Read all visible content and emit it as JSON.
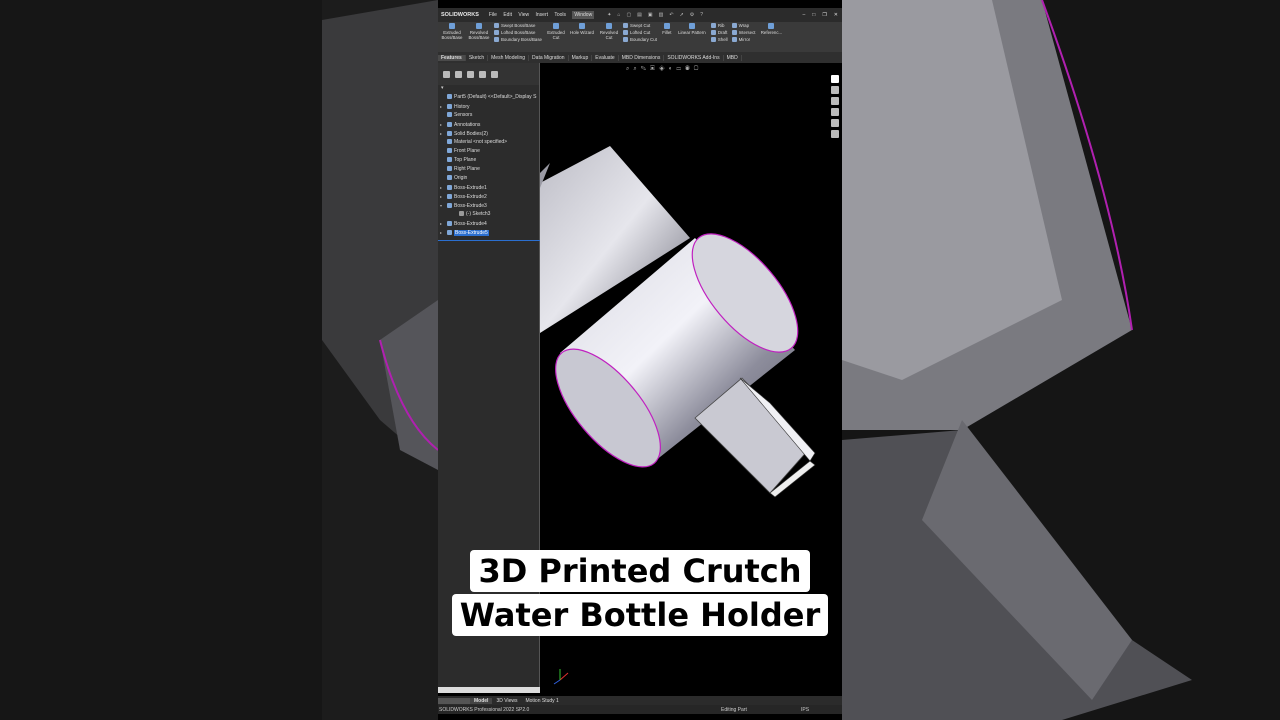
{
  "app": {
    "logo": "SOLIDWORKS",
    "menu": [
      "File",
      "Edit",
      "View",
      "Insert",
      "Tools",
      "Window"
    ],
    "active_menu": "Window"
  },
  "ribbon": {
    "extruded_boss": "Extruded Boss/Base",
    "revolved_boss": "Revolved Boss/Base",
    "swept_boss": "Swept Boss/Base",
    "lofted_boss": "Lofted Boss/Base",
    "boundary_boss": "Boundary Boss/Base",
    "extruded_cut": "Extruded Cut",
    "hole_wizard": "Hole Wizard",
    "revolved_cut": "Revolved Cut",
    "swept_cut": "Swept Cut",
    "lofted_cut": "Lofted Cut",
    "boundary_cut": "Boundary Cut",
    "fillet": "Fillet",
    "linear_pattern": "Linear Pattern",
    "rib": "Rib",
    "draft": "Draft",
    "shell": "Shell",
    "wrap": "Wrap",
    "intersect": "Intersect",
    "mirror": "Mirror",
    "reference": "Referenc..."
  },
  "tabs": [
    "Features",
    "Sketch",
    "Mesh Modeling",
    "Data Migration",
    "Markup",
    "Evaluate",
    "MBD Dimensions",
    "SOLIDWORKS Add-Ins",
    "MBD"
  ],
  "active_tab": "Features",
  "tree": {
    "items": [
      {
        "label": "Part5 (Default) <<Default>_Display S",
        "twist": ""
      },
      {
        "label": "History",
        "twist": "▸"
      },
      {
        "label": "Sensors",
        "twist": ""
      },
      {
        "label": "Annotations",
        "twist": "▸"
      },
      {
        "label": "Solid Bodies(2)",
        "twist": "▸"
      },
      {
        "label": "Material <not specified>",
        "twist": ""
      },
      {
        "label": "Front Plane",
        "twist": ""
      },
      {
        "label": "Top Plane",
        "twist": ""
      },
      {
        "label": "Right Plane",
        "twist": ""
      },
      {
        "label": "Origin",
        "twist": ""
      },
      {
        "label": "Boss-Extrude1",
        "twist": "▸"
      },
      {
        "label": "Boss-Extrude2",
        "twist": "▸"
      },
      {
        "label": "Boss-Extrude3",
        "twist": "▾"
      },
      {
        "label": "(-) Sketch3",
        "twist": ""
      },
      {
        "label": "Boss-Extrude4",
        "twist": "▸"
      },
      {
        "label": "Boss-Extrude5",
        "twist": "▸",
        "selected": true
      }
    ]
  },
  "bottom_tabs": [
    "Model",
    "3D Views",
    "Motion Study 1"
  ],
  "active_bottom_tab": "Model",
  "status": {
    "version": "SOLIDWORKS Professional 2022 SP2.0",
    "mode": "Editing Part",
    "units": "IPS"
  },
  "caption": {
    "line1": "3D Printed Crutch",
    "line2": "Water Bottle Holder"
  },
  "colors": {
    "edge_highlight": "#c020c0",
    "selection": "#2b6fd0"
  }
}
